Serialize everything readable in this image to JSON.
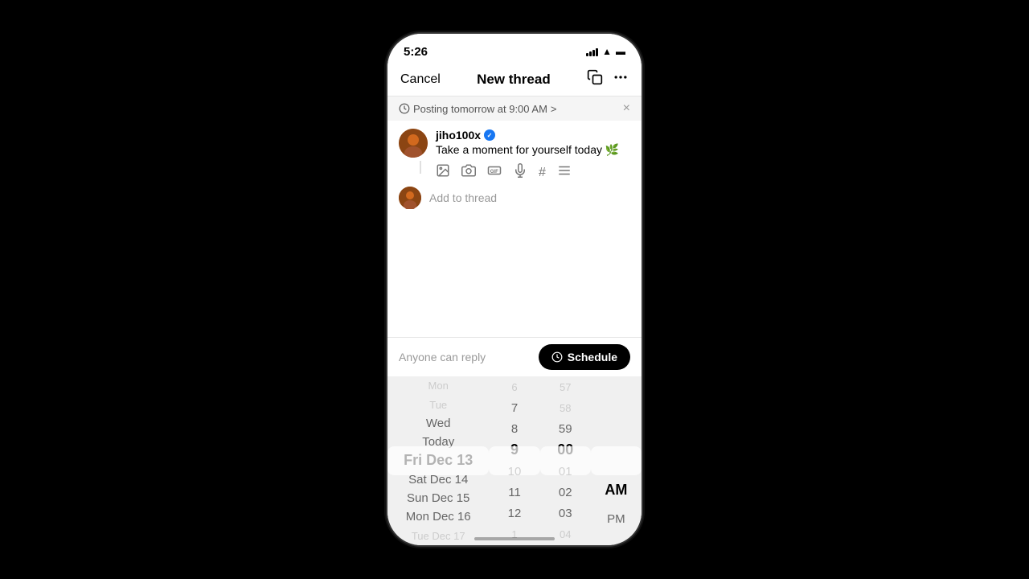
{
  "status_bar": {
    "time": "5:26",
    "signal": "signal",
    "wifi": "wifi",
    "battery": "battery"
  },
  "nav": {
    "cancel_label": "Cancel",
    "title": "New thread",
    "copy_icon": "copy",
    "more_icon": "more"
  },
  "schedule_banner": {
    "text": "Posting tomorrow at 9:00 AM",
    "chevron": ">",
    "close": "×"
  },
  "post": {
    "username": "jiho100x",
    "verified": true,
    "content": "Take a moment for yourself today 🌿",
    "toolbar": {
      "media_icon": "🖼",
      "camera_icon": "📷",
      "gif_icon": "gif",
      "mic_icon": "🎙",
      "tag_icon": "#",
      "list_icon": "≡"
    }
  },
  "add_to_thread": {
    "placeholder": "Add to thread"
  },
  "footer": {
    "reply_label": "Anyone can reply",
    "schedule_button": "Schedule",
    "clock_icon": "🕐"
  },
  "picker": {
    "dates": [
      {
        "label": "Mon",
        "state": "far"
      },
      {
        "label": "Tue",
        "state": "far"
      },
      {
        "label": "Wed",
        "state": "near"
      },
      {
        "label": "Today",
        "state": "near"
      },
      {
        "label": "Fri Dec 13",
        "state": "selected"
      },
      {
        "label": "Sat Dec 14",
        "state": "near"
      },
      {
        "label": "Sun Dec 15",
        "state": "near"
      },
      {
        "label": "Mon Dec 16",
        "state": "near"
      },
      {
        "label": "Tue Dec 17",
        "state": "far"
      }
    ],
    "hours": [
      {
        "label": "6",
        "state": "far"
      },
      {
        "label": "7",
        "state": "near"
      },
      {
        "label": "8",
        "state": "near"
      },
      {
        "label": "9",
        "state": "selected"
      },
      {
        "label": "10",
        "state": "near"
      },
      {
        "label": "11",
        "state": "near"
      },
      {
        "label": "12",
        "state": "near"
      },
      {
        "label": "1",
        "state": "far"
      }
    ],
    "minutes": [
      {
        "label": "57",
        "state": "far"
      },
      {
        "label": "58",
        "state": "far"
      },
      {
        "label": "59",
        "state": "near"
      },
      {
        "label": "00",
        "state": "selected"
      },
      {
        "label": "01",
        "state": "near"
      },
      {
        "label": "02",
        "state": "near"
      },
      {
        "label": "03",
        "state": "near"
      },
      {
        "label": "04",
        "state": "far"
      }
    ],
    "meridiem": [
      {
        "label": "AM",
        "state": "selected"
      },
      {
        "label": "PM",
        "state": "near"
      }
    ]
  }
}
